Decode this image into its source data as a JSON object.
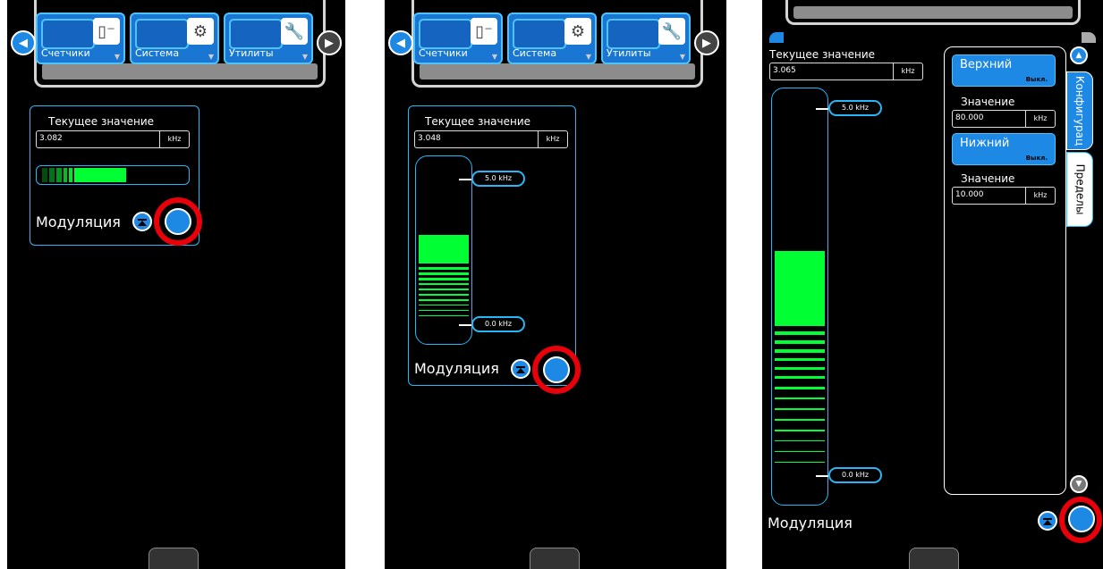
{
  "panels": [
    {
      "menu": [
        {
          "label": "Счетчики",
          "icon": "counter-icon"
        },
        {
          "label": "Система",
          "icon": "gear-icon"
        },
        {
          "label": "Утилиты",
          "icon": "wrench-icon"
        }
      ],
      "current_label": "Текущее значение",
      "value": "3.082",
      "unit": "kHz",
      "modulation_label": "Модуляция"
    },
    {
      "menu": [
        {
          "label": "Счетчики",
          "icon": "counter-icon"
        },
        {
          "label": "Система",
          "icon": "gear-icon"
        },
        {
          "label": "Утилиты",
          "icon": "wrench-icon"
        }
      ],
      "current_label": "Текущее значение",
      "value": "3.048",
      "unit": "kHz",
      "max_marker": "5.0 kHz",
      "min_marker": "0.0 kHz",
      "modulation_label": "Модуляция"
    },
    {
      "current_label": "Текущее значение",
      "value": "3.065",
      "unit": "kHz",
      "max_marker": "5.0 kHz",
      "min_marker": "0.0 kHz",
      "modulation_label": "Модуляция",
      "upper": {
        "label": "Верхний",
        "state": "Выкл.",
        "value_label": "Значение",
        "value": "80.000",
        "unit": "kHz"
      },
      "lower": {
        "label": "Нижний",
        "state": "Выкл.",
        "value_label": "Значение",
        "value": "10.000",
        "unit": "kHz"
      },
      "tabs": [
        "Конфигурац",
        "Пределы"
      ]
    }
  ],
  "colors": {
    "accent": "#1e88e5",
    "meter": "#00ff33",
    "highlight_ring": "#e8000a"
  }
}
